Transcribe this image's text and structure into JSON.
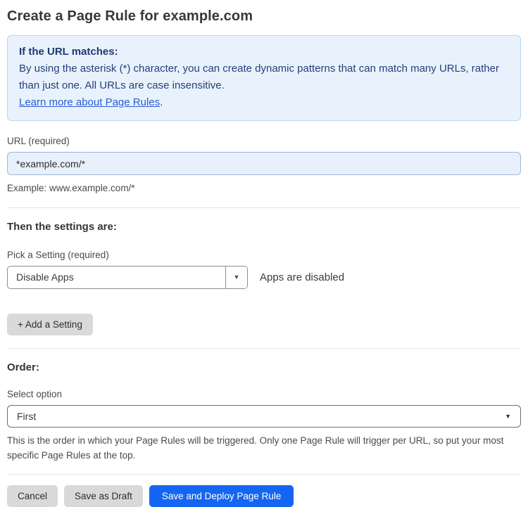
{
  "page": {
    "title": "Create a Page Rule for example.com"
  },
  "info_box": {
    "heading": "If the URL matches:",
    "body": "By using the asterisk (*) character, you can create dynamic patterns that can match many URLs, rather than just one. All URLs are case insensitive.",
    "link_label": "Learn more about Page Rules",
    "link_suffix": "."
  },
  "url_field": {
    "label": "URL (required)",
    "value": "*example.com/*",
    "example": "Example: www.example.com/*"
  },
  "settings_section": {
    "heading": "Then the settings are:",
    "picker_label": "Pick a Setting (required)",
    "selected_setting": "Disable Apps",
    "status_text": "Apps are disabled",
    "add_button_label": "+ Add a Setting"
  },
  "order_section": {
    "heading": "Order:",
    "label": "Select option",
    "selected_option": "First",
    "help_text": "This is the order in which your Page Rules will be triggered. Only one Page Rule will trigger per URL, so put your most specific Page Rules at the top."
  },
  "footer": {
    "cancel_label": "Cancel",
    "save_draft_label": "Save as Draft",
    "save_deploy_label": "Save and Deploy Page Rule"
  },
  "icons": {
    "dropdown_caret": "▼"
  },
  "colors": {
    "primary_button": "#1466f2",
    "secondary_button": "#d9d9d9",
    "info_box_background": "#e9f2fc",
    "info_box_border": "#bcd7f1",
    "info_text": "#24407a",
    "link": "#2a5bd7",
    "url_input_background": "#e7f0fb",
    "url_input_border": "#9fb9d8"
  }
}
